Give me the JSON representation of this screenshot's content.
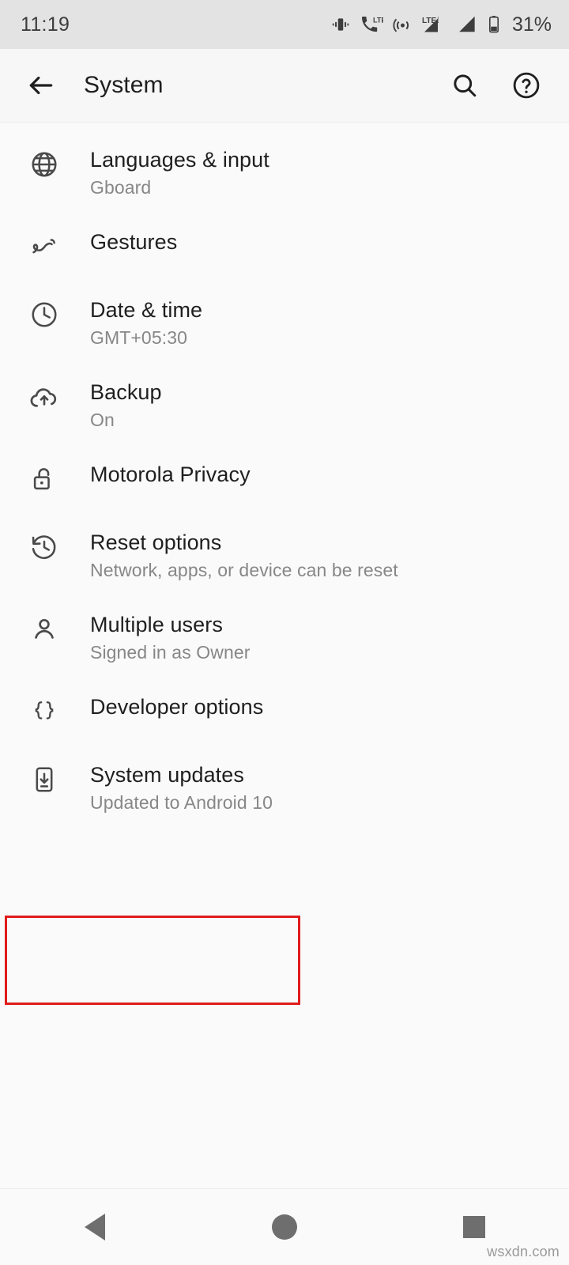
{
  "status_bar": {
    "time": "11:19",
    "battery_percent": "31%",
    "icons": [
      "vibrate-icon",
      "call-lte-icon",
      "hotspot-icon",
      "lte-signal-icon",
      "signal-icon",
      "battery-icon"
    ]
  },
  "app_bar": {
    "title": "System",
    "back_icon": "arrow-back-icon",
    "search_icon": "search-icon",
    "help_icon": "help-circle-icon"
  },
  "settings": {
    "items": [
      {
        "icon": "globe-icon",
        "title": "Languages & input",
        "subtitle": "Gboard"
      },
      {
        "icon": "gesture-icon",
        "title": "Gestures",
        "subtitle": ""
      },
      {
        "icon": "clock-icon",
        "title": "Date & time",
        "subtitle": "GMT+05:30"
      },
      {
        "icon": "cloud-upload-icon",
        "title": "Backup",
        "subtitle": "On"
      },
      {
        "icon": "unlock-icon",
        "title": "Motorola Privacy",
        "subtitle": ""
      },
      {
        "icon": "history-reset-icon",
        "title": "Reset options",
        "subtitle": "Network, apps, or device can be reset"
      },
      {
        "icon": "person-icon",
        "title": "Multiple users",
        "subtitle": "Signed in as Owner"
      },
      {
        "icon": "braces-icon",
        "title": "Developer options",
        "subtitle": ""
      },
      {
        "icon": "phone-update-icon",
        "title": "System updates",
        "subtitle": "Updated to Android 10"
      }
    ]
  },
  "highlight": {
    "color": "#e01b1b",
    "target": "System updates"
  },
  "nav_bar": {
    "back": "nav-back-button",
    "home": "nav-home-button",
    "recents": "nav-recents-button"
  },
  "watermark": "wsxdn.com"
}
